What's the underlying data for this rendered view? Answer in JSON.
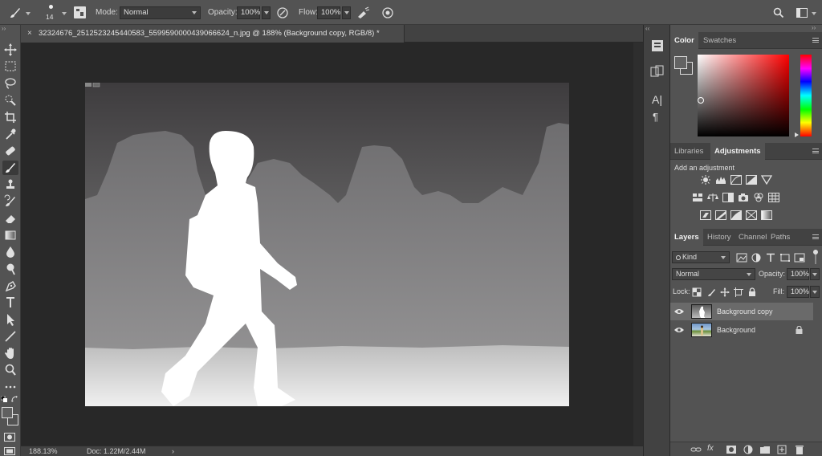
{
  "options_bar": {
    "brush_size": "14",
    "mode_label": "Mode:",
    "mode_value": "Normal",
    "opacity_label": "Opacity:",
    "opacity_value": "100%",
    "flow_label": "Flow:",
    "flow_value": "100%"
  },
  "document": {
    "tab_title": "32324676_2512523245440583_5599590000439066624_n.jpg @ 188% (Background copy, RGB/8) *",
    "zoom": "188.13%",
    "doc_info": "Doc: 1.22M/2.44M"
  },
  "panels": {
    "color_tabs": [
      "Color",
      "Swatches"
    ],
    "adjust_tabs": [
      "Libraries",
      "Adjustments"
    ],
    "add_adjustment_label": "Add an adjustment",
    "layers_tabs": [
      "Layers",
      "History",
      "Channel",
      "Paths"
    ]
  },
  "layers_panel": {
    "filter_kind": "Kind",
    "blend_mode": "Normal",
    "opacity_label": "Opacity:",
    "opacity_value": "100%",
    "lock_label": "Lock:",
    "fill_label": "Fill:",
    "fill_value": "100%",
    "layers": [
      {
        "name": "Background copy",
        "selected": true,
        "locked": false
      },
      {
        "name": "Background",
        "selected": false,
        "locked": true
      }
    ]
  },
  "colors": {
    "chrome": "#535353",
    "panel_dark": "#424242",
    "workspace": "#282828",
    "selected_row": "#6a6a6a"
  }
}
